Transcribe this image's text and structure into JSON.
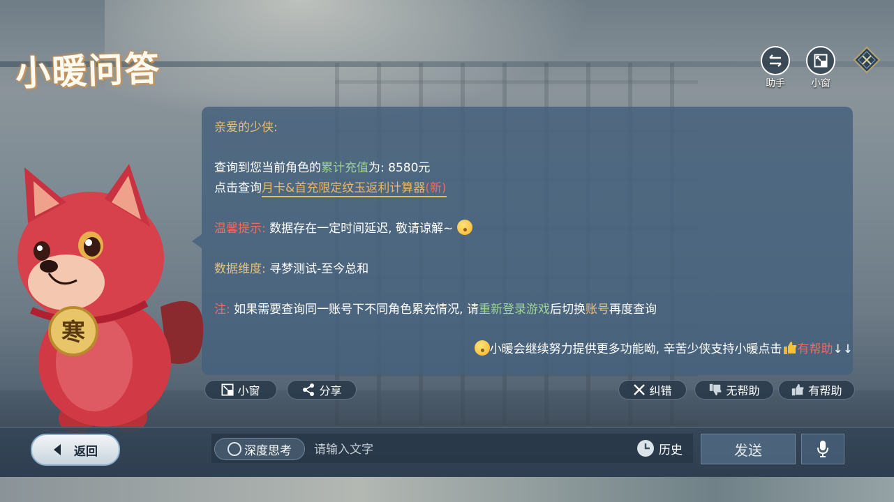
{
  "app": {
    "title": "小暖问答"
  },
  "top_controls": {
    "assistant_label": "助手",
    "mini_window_label": "小窗"
  },
  "message": {
    "greeting": "亲爱的少侠:",
    "query_prefix": "查询到您当前角色的",
    "query_highlight": "累计充值",
    "query_suffix": "为: 8580元",
    "calc_prefix": "点击查询",
    "calc_link": "月卡&首充限定纹玉返利计算器",
    "calc_new": "(新)",
    "tip_label": "温馨提示:",
    "tip_text": " 数据存在一定时间延迟, 敬请谅解~",
    "dimension_label": "数据维度:",
    "dimension_text": " 寻梦测试-至今总和",
    "note_label": "注:",
    "note_text1": " 如果需要查询同一账号下不同角色累充情况, 请",
    "note_highlight1": "重新登录游戏",
    "note_text2": "后切换",
    "note_highlight2": "账号",
    "note_text3": "再度查询",
    "footer_text": "小暖会继续努力提供更多功能呦, 辛苦少侠支持小暖点击",
    "footer_helpful": "有帮助",
    "footer_arrows": "↓↓"
  },
  "message_actions": {
    "mini_window": "小窗",
    "share": "分享",
    "report": "纠错",
    "not_helpful": "无帮助",
    "helpful": "有帮助"
  },
  "bottom_bar": {
    "back": "返回",
    "deep_think": "深度思考",
    "input_placeholder": "请输入文字",
    "history": "历史",
    "send": "发送"
  },
  "character": {
    "badge_text": "寒"
  },
  "colors": {
    "panel": "#44607c",
    "gold": "#e3c17e",
    "green": "#9fd39b",
    "red": "#f26a5f",
    "link": "#e8b86b"
  }
}
